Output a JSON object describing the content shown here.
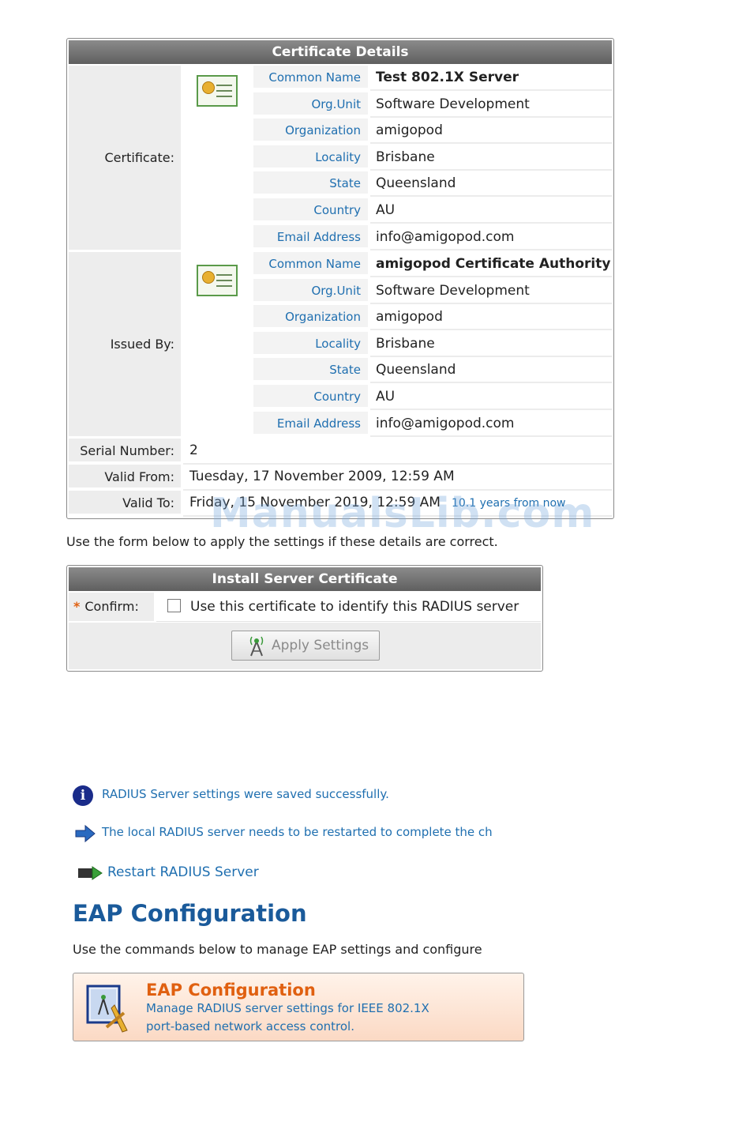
{
  "certificate_details": {
    "title": "Certificate Details",
    "certificate_label": "Certificate:",
    "issued_by_label": "Issued By:",
    "certificate": [
      {
        "name": "Common Name",
        "value": "Test 802.1X Server"
      },
      {
        "name": "Org.Unit",
        "value": "Software Development"
      },
      {
        "name": "Organization",
        "value": "amigopod"
      },
      {
        "name": "Locality",
        "value": "Brisbane"
      },
      {
        "name": "State",
        "value": "Queensland"
      },
      {
        "name": "Country",
        "value": "AU"
      },
      {
        "name": "Email Address",
        "value": "info@amigopod.com"
      }
    ],
    "issued_by": [
      {
        "name": "Common Name",
        "value": "amigopod Certificate Authority"
      },
      {
        "name": "Org.Unit",
        "value": "Software Development"
      },
      {
        "name": "Organization",
        "value": "amigopod"
      },
      {
        "name": "Locality",
        "value": "Brisbane"
      },
      {
        "name": "State",
        "value": "Queensland"
      },
      {
        "name": "Country",
        "value": "AU"
      },
      {
        "name": "Email Address",
        "value": "info@amigopod.com"
      }
    ],
    "serial_label": "Serial Number:",
    "serial_value": "2",
    "valid_from_label": "Valid From:",
    "valid_from_value": "Tuesday, 17 November 2009, 12:59 AM",
    "valid_to_label": "Valid To:",
    "valid_to_value": "Friday, 15 November 2019, 12:59 AM",
    "valid_to_relative": "10.1 years from now"
  },
  "intro_text": "Use the form below to apply the settings if these details are correct.",
  "install": {
    "title": "Install Server Certificate",
    "required_mark": "*",
    "confirm_label": "Confirm:",
    "confirm_text": "Use this certificate to identify this RADIUS server",
    "apply_button": "Apply Settings"
  },
  "messages": {
    "saved": "RADIUS Server settings were saved successfully.",
    "restart_needed": "The local RADIUS server needs to be restarted to complete the ch",
    "restart_link": "Restart RADIUS Server"
  },
  "eap": {
    "heading": "EAP Configuration",
    "description": "Use the commands below to manage EAP settings and configure",
    "card_title": "EAP Configuration",
    "card_line1": "Manage RADIUS server settings for IEEE 802.1X",
    "card_line2": "port-based network access control."
  },
  "watermark": "ManualsLib.com",
  "colors": {
    "link_blue": "#1f6fb0",
    "header_gray": "#6f6f6f",
    "accent_orange": "#e06010",
    "heading_blue": "#1a5a9a"
  }
}
